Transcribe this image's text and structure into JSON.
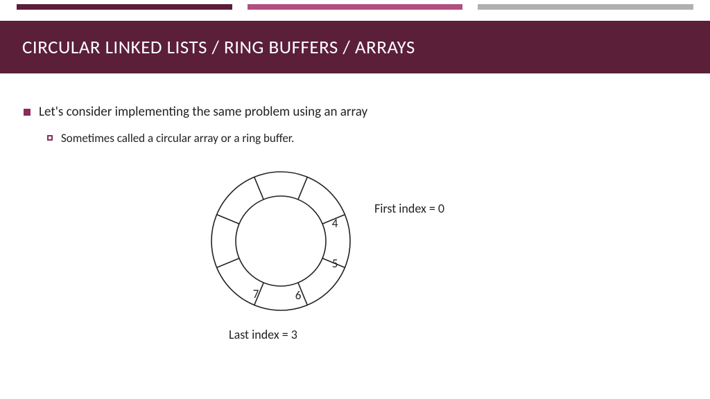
{
  "title": "CIRCULAR LINKED LISTS / RING BUFFERS / ARRAYS",
  "bullets": [
    {
      "text": "Let's consider implementing the same problem using an array",
      "children": [
        {
          "text": "Sometimes called a circular array or a ring buffer."
        }
      ]
    }
  ],
  "ring": {
    "segments": 8,
    "cells": [
      "4",
      "5",
      "6",
      "7",
      "",
      "",
      "",
      ""
    ],
    "first_label": "First index = 0",
    "last_label": "Last index = 3",
    "first_index": 0,
    "last_index": 3
  },
  "colors": {
    "brand_dark": "#5B1F3A",
    "brand_mid": "#B14F81",
    "brand_gray": "#B0B0B0",
    "bullet": "#8B2B58"
  }
}
